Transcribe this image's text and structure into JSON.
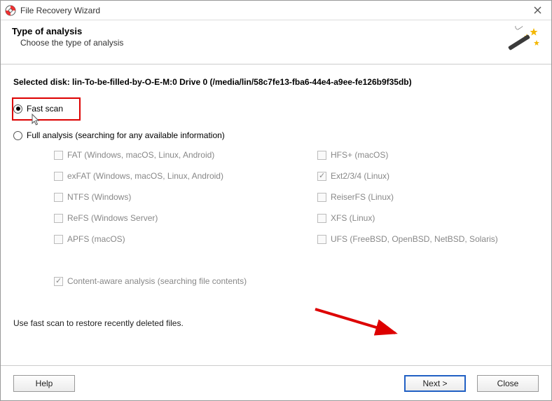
{
  "window": {
    "title": "File Recovery Wizard"
  },
  "header": {
    "title": "Type of analysis",
    "subtitle": "Choose the type of analysis"
  },
  "body": {
    "selected_disk": "Selected disk: lin-To-be-filled-by-O-E-M:0 Drive 0 (/media/lin/58c7fe13-fba6-44e4-a9ee-fe126b9f35db)",
    "fast_scan_label": "Fast scan",
    "full_analysis_label": "Full analysis (searching for any available information)",
    "content_aware_label": "Content-aware analysis (searching file contents)",
    "hint": "Use fast scan to restore recently deleted files."
  },
  "fs_left": {
    "fat": "FAT (Windows, macOS, Linux, Android)",
    "exfat": "exFAT (Windows, macOS, Linux, Android)",
    "ntfs": "NTFS (Windows)",
    "refs": "ReFS (Windows Server)",
    "apfs": "APFS (macOS)"
  },
  "fs_right": {
    "hfs": "HFS+ (macOS)",
    "ext": "Ext2/3/4 (Linux)",
    "reiser": "ReiserFS (Linux)",
    "xfs": "XFS (Linux)",
    "ufs": "UFS (FreeBSD, OpenBSD, NetBSD, Solaris)"
  },
  "footer": {
    "help": "Help",
    "next": "Next >",
    "close": "Close"
  }
}
